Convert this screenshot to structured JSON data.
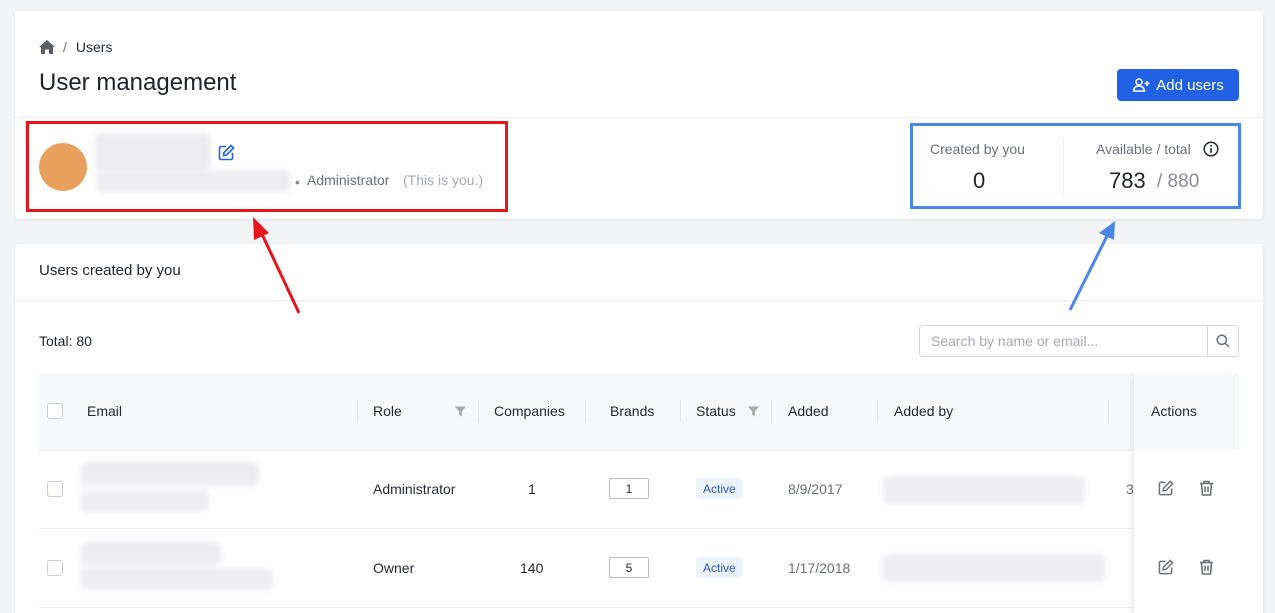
{
  "breadcrumb": {
    "current": "Users",
    "separator": "/"
  },
  "header": {
    "title": "User management",
    "add_button_label": "Add users"
  },
  "current_user": {
    "role": "Administrator",
    "note": "(This is you.)",
    "separator": "•"
  },
  "stats": {
    "created_label": "Created by you",
    "created_value": "0",
    "available_label": "Available / total",
    "available_value": "783",
    "total_value": "/ 880"
  },
  "users_section": {
    "title": "Users created by you",
    "total_label": "Total: 80",
    "search_placeholder": "Search by name or email..."
  },
  "table": {
    "columns": {
      "email": "Email",
      "role": "Role",
      "companies": "Companies",
      "brands": "Brands",
      "status": "Status",
      "added": "Added",
      "added_by": "Added by",
      "actions": "Actions"
    },
    "rows": [
      {
        "role": "Administrator",
        "companies": "1",
        "brands": "1",
        "status": "Active",
        "added": "8/9/2017",
        "clipped": "3"
      },
      {
        "role": "Owner",
        "companies": "140",
        "brands": "5",
        "status": "Active",
        "added": "1/17/2018",
        "clipped": ""
      }
    ]
  },
  "colors": {
    "primary": "#2260e4",
    "highlight_red": "#e8141b",
    "highlight_blue": "#4a86e8",
    "avatar": "#e8a15c"
  },
  "icons": [
    "home-icon",
    "edit-icon",
    "add-user-icon",
    "info-icon",
    "filter-icon",
    "search-icon",
    "delete-icon"
  ]
}
